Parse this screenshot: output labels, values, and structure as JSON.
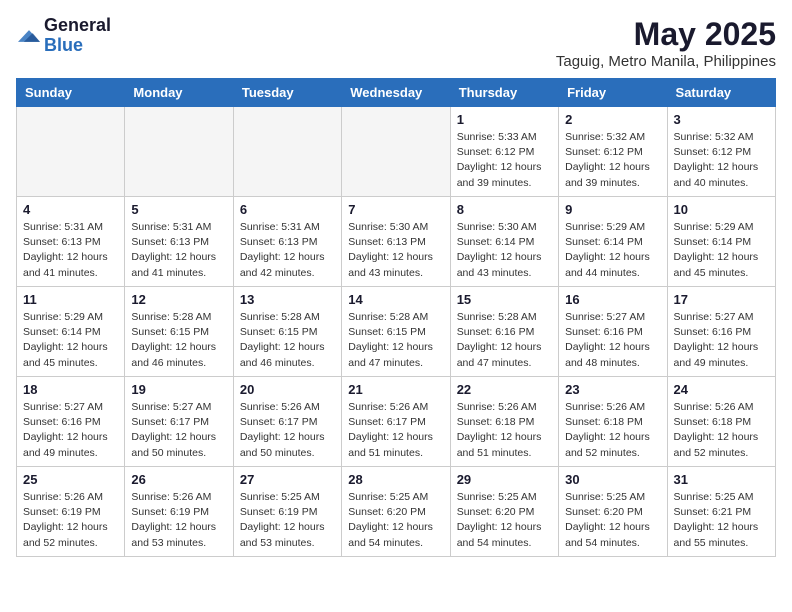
{
  "header": {
    "logo_general": "General",
    "logo_blue": "Blue",
    "title": "May 2025",
    "subtitle": "Taguig, Metro Manila, Philippines"
  },
  "weekdays": [
    "Sunday",
    "Monday",
    "Tuesday",
    "Wednesday",
    "Thursday",
    "Friday",
    "Saturday"
  ],
  "weeks": [
    [
      {
        "day": "",
        "info": ""
      },
      {
        "day": "",
        "info": ""
      },
      {
        "day": "",
        "info": ""
      },
      {
        "day": "",
        "info": ""
      },
      {
        "day": "1",
        "info": "Sunrise: 5:33 AM\nSunset: 6:12 PM\nDaylight: 12 hours\nand 39 minutes."
      },
      {
        "day": "2",
        "info": "Sunrise: 5:32 AM\nSunset: 6:12 PM\nDaylight: 12 hours\nand 39 minutes."
      },
      {
        "day": "3",
        "info": "Sunrise: 5:32 AM\nSunset: 6:12 PM\nDaylight: 12 hours\nand 40 minutes."
      }
    ],
    [
      {
        "day": "4",
        "info": "Sunrise: 5:31 AM\nSunset: 6:13 PM\nDaylight: 12 hours\nand 41 minutes."
      },
      {
        "day": "5",
        "info": "Sunrise: 5:31 AM\nSunset: 6:13 PM\nDaylight: 12 hours\nand 41 minutes."
      },
      {
        "day": "6",
        "info": "Sunrise: 5:31 AM\nSunset: 6:13 PM\nDaylight: 12 hours\nand 42 minutes."
      },
      {
        "day": "7",
        "info": "Sunrise: 5:30 AM\nSunset: 6:13 PM\nDaylight: 12 hours\nand 43 minutes."
      },
      {
        "day": "8",
        "info": "Sunrise: 5:30 AM\nSunset: 6:14 PM\nDaylight: 12 hours\nand 43 minutes."
      },
      {
        "day": "9",
        "info": "Sunrise: 5:29 AM\nSunset: 6:14 PM\nDaylight: 12 hours\nand 44 minutes."
      },
      {
        "day": "10",
        "info": "Sunrise: 5:29 AM\nSunset: 6:14 PM\nDaylight: 12 hours\nand 45 minutes."
      }
    ],
    [
      {
        "day": "11",
        "info": "Sunrise: 5:29 AM\nSunset: 6:14 PM\nDaylight: 12 hours\nand 45 minutes."
      },
      {
        "day": "12",
        "info": "Sunrise: 5:28 AM\nSunset: 6:15 PM\nDaylight: 12 hours\nand 46 minutes."
      },
      {
        "day": "13",
        "info": "Sunrise: 5:28 AM\nSunset: 6:15 PM\nDaylight: 12 hours\nand 46 minutes."
      },
      {
        "day": "14",
        "info": "Sunrise: 5:28 AM\nSunset: 6:15 PM\nDaylight: 12 hours\nand 47 minutes."
      },
      {
        "day": "15",
        "info": "Sunrise: 5:28 AM\nSunset: 6:16 PM\nDaylight: 12 hours\nand 47 minutes."
      },
      {
        "day": "16",
        "info": "Sunrise: 5:27 AM\nSunset: 6:16 PM\nDaylight: 12 hours\nand 48 minutes."
      },
      {
        "day": "17",
        "info": "Sunrise: 5:27 AM\nSunset: 6:16 PM\nDaylight: 12 hours\nand 49 minutes."
      }
    ],
    [
      {
        "day": "18",
        "info": "Sunrise: 5:27 AM\nSunset: 6:16 PM\nDaylight: 12 hours\nand 49 minutes."
      },
      {
        "day": "19",
        "info": "Sunrise: 5:27 AM\nSunset: 6:17 PM\nDaylight: 12 hours\nand 50 minutes."
      },
      {
        "day": "20",
        "info": "Sunrise: 5:26 AM\nSunset: 6:17 PM\nDaylight: 12 hours\nand 50 minutes."
      },
      {
        "day": "21",
        "info": "Sunrise: 5:26 AM\nSunset: 6:17 PM\nDaylight: 12 hours\nand 51 minutes."
      },
      {
        "day": "22",
        "info": "Sunrise: 5:26 AM\nSunset: 6:18 PM\nDaylight: 12 hours\nand 51 minutes."
      },
      {
        "day": "23",
        "info": "Sunrise: 5:26 AM\nSunset: 6:18 PM\nDaylight: 12 hours\nand 52 minutes."
      },
      {
        "day": "24",
        "info": "Sunrise: 5:26 AM\nSunset: 6:18 PM\nDaylight: 12 hours\nand 52 minutes."
      }
    ],
    [
      {
        "day": "25",
        "info": "Sunrise: 5:26 AM\nSunset: 6:19 PM\nDaylight: 12 hours\nand 52 minutes."
      },
      {
        "day": "26",
        "info": "Sunrise: 5:26 AM\nSunset: 6:19 PM\nDaylight: 12 hours\nand 53 minutes."
      },
      {
        "day": "27",
        "info": "Sunrise: 5:25 AM\nSunset: 6:19 PM\nDaylight: 12 hours\nand 53 minutes."
      },
      {
        "day": "28",
        "info": "Sunrise: 5:25 AM\nSunset: 6:20 PM\nDaylight: 12 hours\nand 54 minutes."
      },
      {
        "day": "29",
        "info": "Sunrise: 5:25 AM\nSunset: 6:20 PM\nDaylight: 12 hours\nand 54 minutes."
      },
      {
        "day": "30",
        "info": "Sunrise: 5:25 AM\nSunset: 6:20 PM\nDaylight: 12 hours\nand 54 minutes."
      },
      {
        "day": "31",
        "info": "Sunrise: 5:25 AM\nSunset: 6:21 PM\nDaylight: 12 hours\nand 55 minutes."
      }
    ]
  ]
}
